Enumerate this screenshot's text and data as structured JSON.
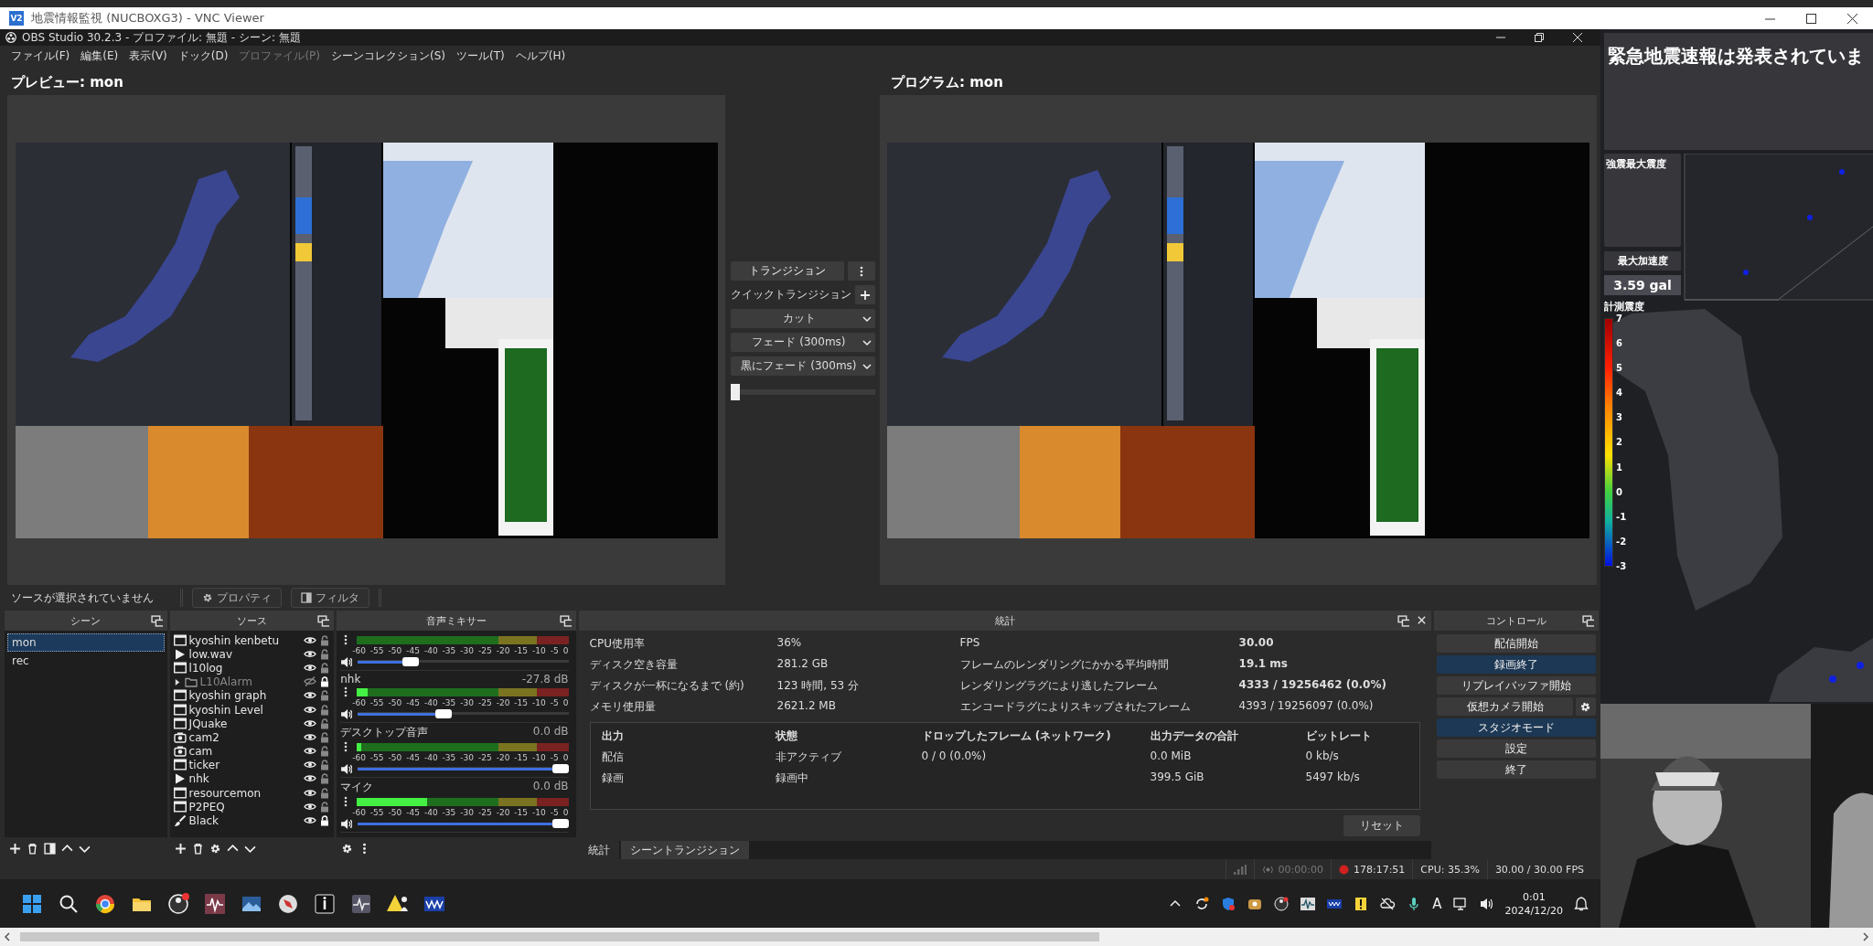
{
  "vnc_window": {
    "badge": "V2",
    "title": "地震情報監視 (NUCBOXG3) - VNC Viewer"
  },
  "obs": {
    "title": "OBS Studio 30.2.3 - プロファイル: 無題 - シーン: 無題",
    "menu": [
      {
        "label": "ファイル(F)",
        "disabled": false
      },
      {
        "label": "編集(E)",
        "disabled": false
      },
      {
        "label": "表示(V)",
        "disabled": false
      },
      {
        "label": "ドック(D)",
        "disabled": false
      },
      {
        "label": "プロファイル(P)",
        "disabled": true
      },
      {
        "label": "シーンコレクション(S)",
        "disabled": false
      },
      {
        "label": "ツール(T)",
        "disabled": false
      },
      {
        "label": "ヘルプ(H)",
        "disabled": false
      }
    ],
    "preview": {
      "label": "プレビュー: mon",
      "kind": "picture"
    },
    "program": {
      "label": "プログラム: mon",
      "kind": "picture"
    },
    "transitions": {
      "transition_button": "トランジション",
      "quick_label": "クイックトランジション",
      "quick_items": [
        "カット",
        "フェード (300ms)",
        "黒にフェード (300ms)"
      ],
      "tbar": {
        "level": 0
      }
    },
    "source_toolbar": {
      "status": "ソースが選択されていません",
      "properties_button": "プロパティ",
      "filters_button": "フィルタ"
    },
    "scenes": {
      "title": "シーン",
      "items": [
        {
          "name": "mon",
          "selected": true
        },
        {
          "name": "rec",
          "selected": false
        }
      ]
    },
    "sources": {
      "title": "ソース",
      "items": [
        {
          "name": "kyoshin kenbetu",
          "kind": "window",
          "visible": true,
          "locked": false
        },
        {
          "name": "low.wav",
          "kind": "media",
          "visible": true,
          "locked": false
        },
        {
          "name": "l10log",
          "kind": "window",
          "visible": true,
          "locked": false
        },
        {
          "name": "L10Alarm",
          "kind": "folder",
          "visible": false,
          "locked": true
        },
        {
          "name": "kyoshin graph",
          "kind": "window",
          "visible": true,
          "locked": false
        },
        {
          "name": "kyoshin Level",
          "kind": "window",
          "visible": true,
          "locked": false
        },
        {
          "name": "JQuake",
          "kind": "window",
          "visible": true,
          "locked": false
        },
        {
          "name": "cam2",
          "kind": "camera",
          "visible": true,
          "locked": false
        },
        {
          "name": "cam",
          "kind": "camera",
          "visible": true,
          "locked": false
        },
        {
          "name": "ticker",
          "kind": "window",
          "visible": true,
          "locked": false
        },
        {
          "name": "nhk",
          "kind": "media",
          "visible": true,
          "locked": false
        },
        {
          "name": "resourcemon",
          "kind": "window",
          "visible": true,
          "locked": false
        },
        {
          "name": "P2PEQ",
          "kind": "window",
          "visible": true,
          "locked": false
        },
        {
          "name": "Black",
          "kind": "brush",
          "visible": true,
          "locked": true
        }
      ]
    },
    "mixer": {
      "title": "音声ミキサー",
      "channels": [
        {
          "meter": {
            "level": 0
          },
          "ticks": [
            "-60",
            "-55",
            "-50",
            "-45",
            "-40",
            "-35",
            "-30",
            "-25",
            "-20",
            "-15",
            "-10",
            "-5",
            "0"
          ],
          "volume": {
            "level": 0.23
          }
        },
        {
          "name": "nhk",
          "reading": "-27.8 dB",
          "meter": {
            "level": 0.05
          },
          "ticks": [
            "-60",
            "-55",
            "-50",
            "-45",
            "-40",
            "-35",
            "-30",
            "-25",
            "-20",
            "-15",
            "-10",
            "-5",
            "0"
          ],
          "volume": {
            "level": 0.4
          }
        },
        {
          "name": "デスクトップ音声",
          "reading": "0.0 dB",
          "meter": {
            "level": 0.02
          },
          "ticks": [
            "-60",
            "-55",
            "-50",
            "-45",
            "-40",
            "-35",
            "-30",
            "-25",
            "-20",
            "-15",
            "-10",
            "-5",
            "0"
          ],
          "volume": {
            "level": 1
          }
        },
        {
          "name": "マイク",
          "reading": "0.0 dB",
          "meter": {
            "level": 0.33
          },
          "ticks": [
            "-60",
            "-55",
            "-50",
            "-45",
            "-40",
            "-35",
            "-30",
            "-25",
            "-20",
            "-15",
            "-10",
            "-5",
            "0"
          ],
          "volume": {
            "level": 1
          }
        }
      ]
    },
    "stats": {
      "title": "統計",
      "left": [
        {
          "label": "CPU使用率",
          "value": "36%"
        },
        {
          "label": "ディスク空き容量",
          "value": "281.2 GB"
        },
        {
          "label": "ディスクが一杯になるまで (約)",
          "value": "123 時間, 53 分"
        },
        {
          "label": "メモリ使用量",
          "value": "2621.2 MB"
        }
      ],
      "right": [
        {
          "label": "FPS",
          "value": "30.00",
          "bold": true
        },
        {
          "label": "フレームのレンダリングにかかる平均時間",
          "value": "19.1 ms",
          "bold": true
        },
        {
          "label": "レンダリングラグにより逃したフレーム",
          "value": "4333 / 19256462 (0.0%)",
          "bold": true
        },
        {
          "label": "エンコードラグによりスキップされたフレーム",
          "value": "4393 / 19256097 (0.0%)",
          "bold": false
        }
      ],
      "output_columns": [
        "出力",
        "状態",
        "ドロップしたフレーム (ネットワーク)",
        "出力データの合計",
        "ビットレート"
      ],
      "outputs": [
        {
          "output": "配信",
          "state": "非アクティブ",
          "dropped": "0 / 0 (0.0%)",
          "total": "0.0 MiB",
          "bitrate": "0 kb/s"
        },
        {
          "output": "録画",
          "state": "録画中",
          "total": "399.5 GiB",
          "bitrate": "5497 kb/s"
        }
      ],
      "reset_button": "リセット",
      "tabs": [
        {
          "label": "統計",
          "selected": true
        },
        {
          "label": "シーントランジション",
          "selected": false
        }
      ]
    },
    "controls": {
      "title": "コントロール",
      "buttons": [
        {
          "label": "配信開始",
          "active": false
        },
        {
          "label": "録画終了",
          "active": true
        },
        {
          "label": "リプレイバッファ開始",
          "active": false
        },
        {
          "label": "仮想カメラ開始",
          "active": false,
          "settings": true
        },
        {
          "label": "スタジオモード",
          "active": true
        },
        {
          "label": "設定",
          "active": false
        },
        {
          "label": "終了",
          "active": false
        }
      ]
    },
    "status_bar": {
      "streaming": false,
      "stream_time": "00:00:00",
      "recording": true,
      "record_time": "178:17:51",
      "cpu": "CPU: 35.3%",
      "fps": "30.00 / 30.00 FPS"
    }
  },
  "taskbar": {
    "ime": "A",
    "time": "0:01",
    "date": "2024/12/20"
  },
  "quake_app": {
    "banner": "緊急地震速報は発表されていま",
    "max_intensity_label": "強震最大震度",
    "max_accel_label": "最大加速度",
    "max_accel": "3.59 gal",
    "scale_label": "計測震度",
    "scale_ticks": [
      "7",
      "6",
      "5",
      "4",
      "3",
      "2",
      "1",
      "0",
      "-1",
      "-2",
      "-3"
    ]
  }
}
